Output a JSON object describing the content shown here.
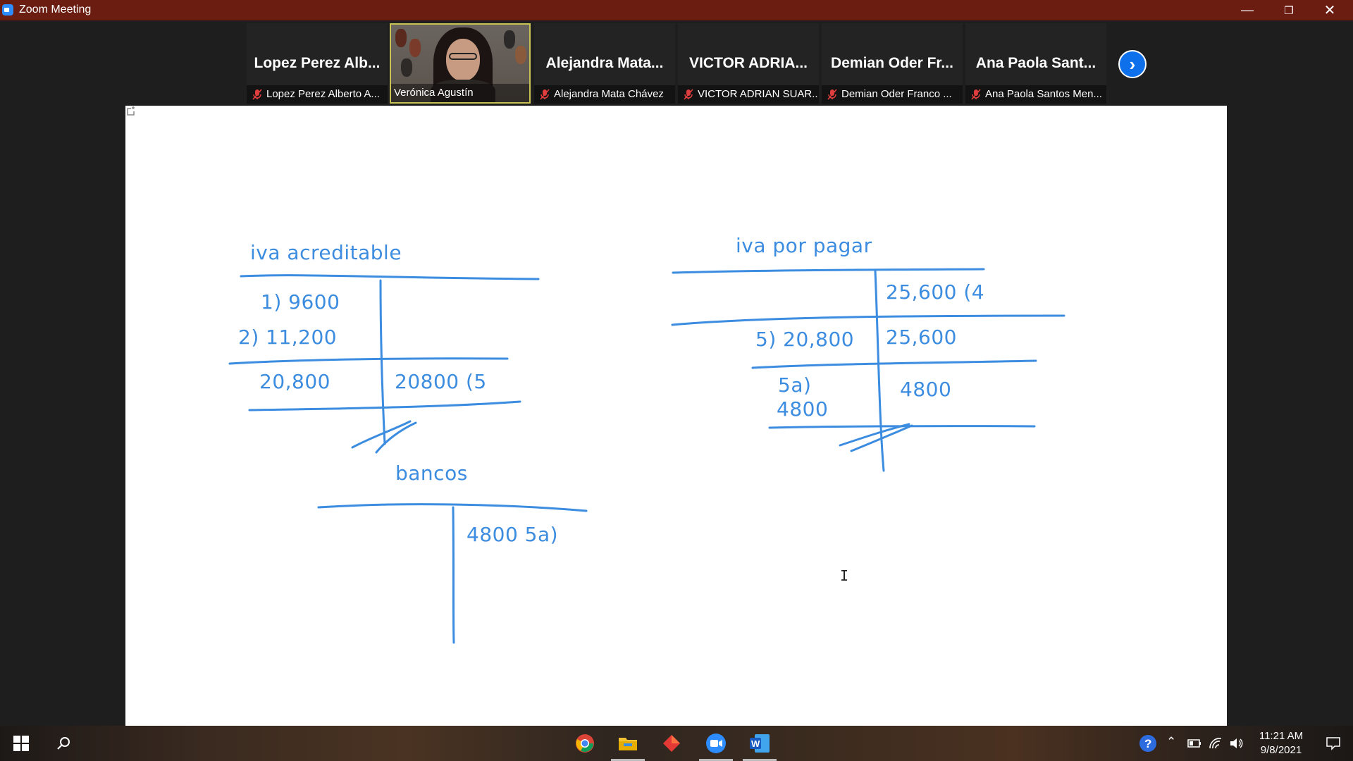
{
  "window": {
    "title": "Zoom Meeting"
  },
  "participants": [
    {
      "big": "Lopez Perez Alb...",
      "label": "Lopez Perez Alberto A..."
    },
    {
      "label": "Verónica Agustín"
    },
    {
      "big": "Alejandra  Mata...",
      "label": "Alejandra Mata Chávez"
    },
    {
      "big": "VICTOR  ADRIA...",
      "label": "VICTOR ADRIAN SUAR..."
    },
    {
      "big": "Demian Oder Fr...",
      "label": "Demian Oder Franco ..."
    },
    {
      "big": "Ana Paola Sant...",
      "label": "Ana Paola Santos Men..."
    }
  ],
  "whiteboard": {
    "iva_acreditable": {
      "title": "iva acreditable",
      "debit_1": "1)  9600",
      "debit_2": "2)  11,200",
      "debit_total": "20,800",
      "credit_1": "20800  (5"
    },
    "iva_por_pagar": {
      "title": "iva por pagar",
      "credit_1": "25,600  (4",
      "debit_1": "5)  20,800",
      "credit_2": "25,600",
      "debit_2a": "5a)",
      "debit_2b": "4800",
      "credit_3": "4800"
    },
    "bancos": {
      "title": "bancos",
      "credit_1": "4800  5a)"
    },
    "ink_color": "#3c8ce0"
  },
  "taskbar": {
    "time": "11:21 AM",
    "date": "9/8/2021",
    "apps": [
      "chrome-icon",
      "file-explorer-icon",
      "app-red-icon",
      "zoom-icon",
      "word-icon"
    ]
  }
}
